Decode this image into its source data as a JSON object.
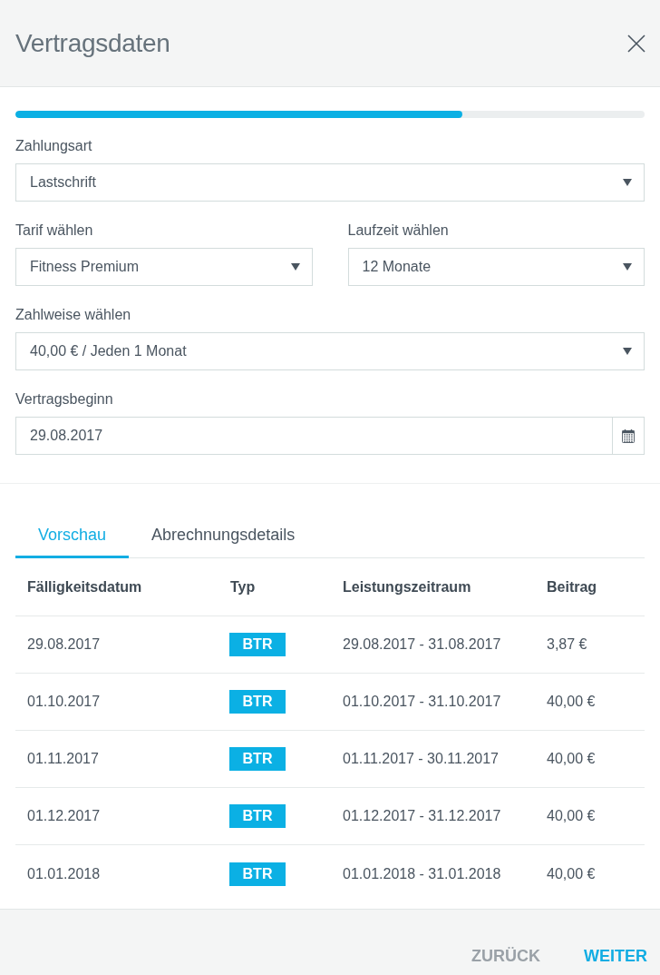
{
  "dialog": {
    "title": "Vertragsdaten"
  },
  "progress": {
    "level": 0.71
  },
  "form": {
    "rows": [
      {
        "fields": [
          {
            "kind": "select",
            "label": "Zahlungsart",
            "value": "Lastschrift"
          }
        ]
      },
      {
        "fields": [
          {
            "kind": "select",
            "label": "Tarif wählen",
            "value": "Fitness Premium"
          },
          {
            "kind": "select",
            "label": "Laufzeit wählen",
            "value": "12 Monate"
          }
        ]
      },
      {
        "fields": [
          {
            "kind": "select",
            "label": "Zahlweise wählen",
            "value": "40,00 € / Jeden 1 Monat"
          }
        ]
      },
      {
        "fields": [
          {
            "kind": "date",
            "label": "Vertragsbeginn",
            "value": "29.08.2017"
          }
        ]
      }
    ]
  },
  "tabs": [
    {
      "label": "Vorschau",
      "selected": true
    },
    {
      "label": "Abrechnungsdetails",
      "selected": false
    }
  ],
  "table": {
    "columns": [
      "Fälligkeitsdatum",
      "Typ",
      "Leistungszeitraum",
      "Beitrag"
    ],
    "rows": [
      {
        "due_date": "29.08.2017",
        "type": "BTR",
        "period": "29.08.2017 - 31.08.2017",
        "amount": "3,87 €"
      },
      {
        "due_date": "01.10.2017",
        "type": "BTR",
        "period": "01.10.2017 - 31.10.2017",
        "amount": "40,00 €"
      },
      {
        "due_date": "01.11.2017",
        "type": "BTR",
        "period": "01.11.2017 - 30.11.2017",
        "amount": "40,00 €"
      },
      {
        "due_date": "01.12.2017",
        "type": "BTR",
        "period": "01.12.2017 - 31.12.2017",
        "amount": "40,00 €"
      },
      {
        "due_date": "01.01.2018",
        "type": "BTR",
        "period": "01.01.2018 - 31.01.2018",
        "amount": "40,00 €"
      }
    ]
  },
  "footer": {
    "buttons": [
      {
        "label": "ZURÜCK",
        "kind": "secondary"
      },
      {
        "label": "WEITER",
        "kind": "primary"
      }
    ]
  }
}
